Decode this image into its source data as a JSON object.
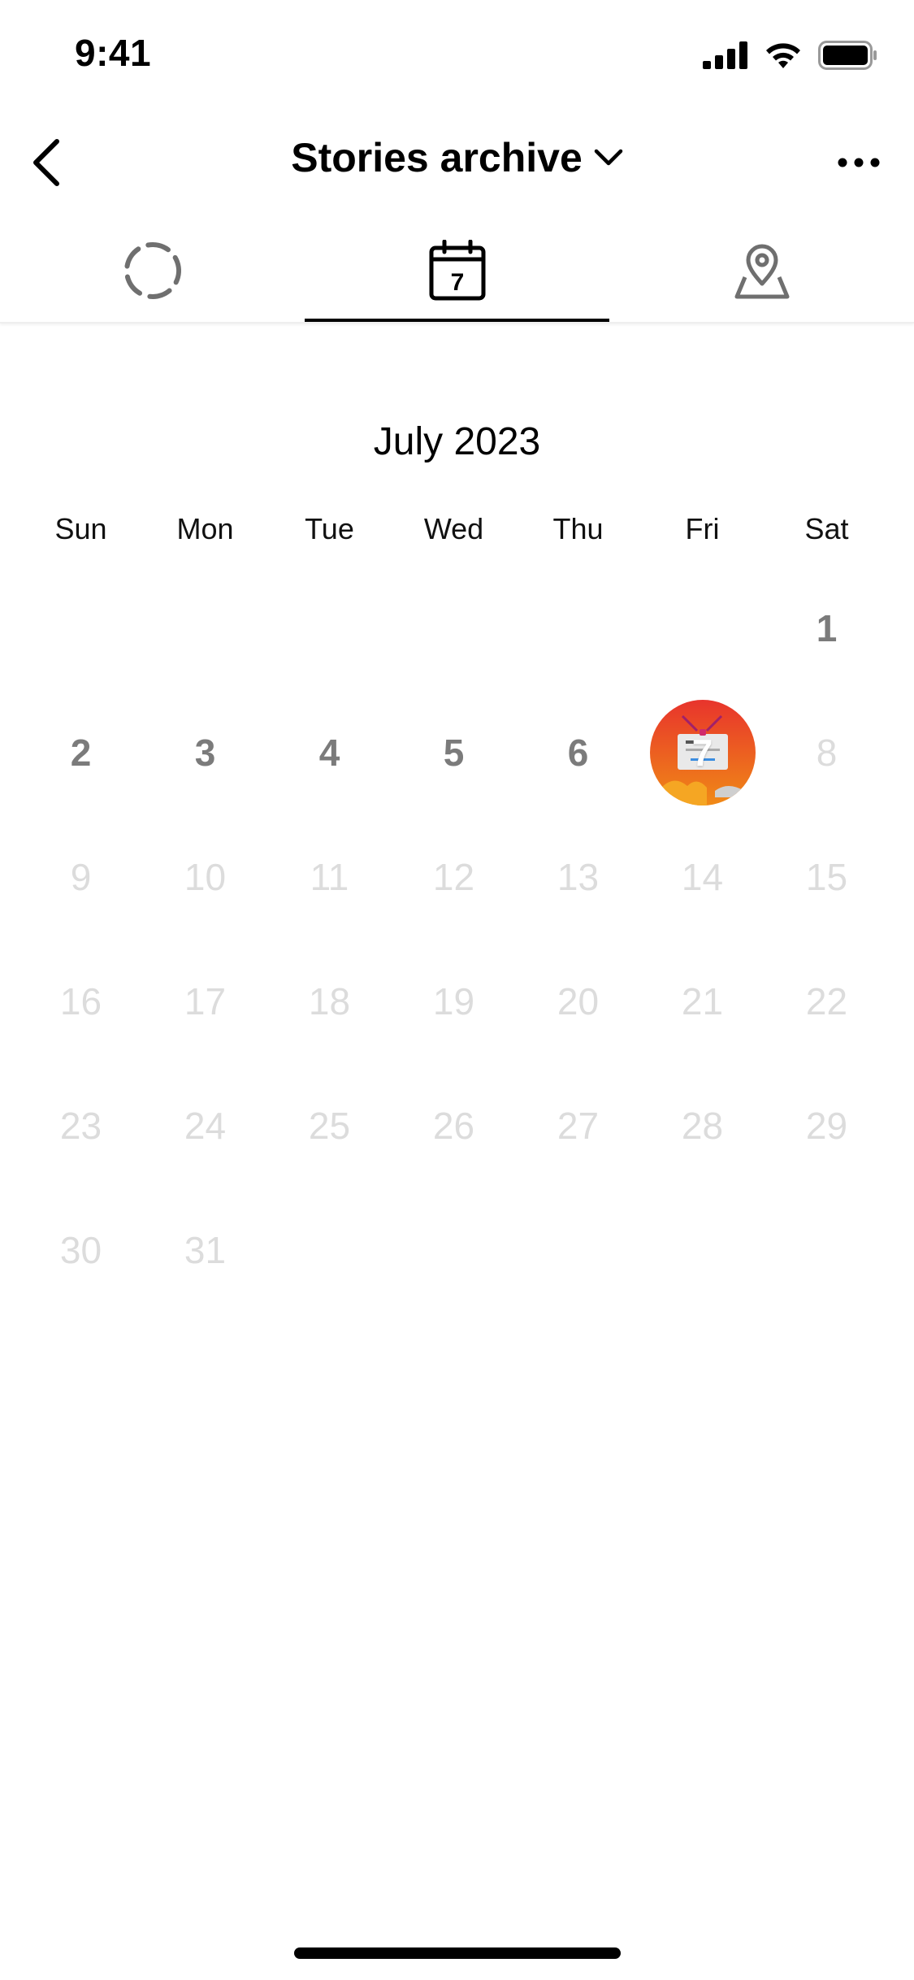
{
  "status_bar": {
    "time": "9:41",
    "icons": [
      "cellular-signal-icon",
      "wifi-icon",
      "battery-icon"
    ]
  },
  "nav": {
    "back_icon": "chevron-left-icon",
    "title": "Stories archive",
    "title_dropdown_icon": "chevron-down-icon",
    "more_icon": "more-horizontal-icon"
  },
  "tabs": [
    {
      "icon": "dashed-circle-icon",
      "active": false
    },
    {
      "icon": "calendar-icon",
      "icon_number": "7",
      "active": true
    },
    {
      "icon": "map-pin-icon",
      "active": false
    }
  ],
  "calendar": {
    "month": "July 2023",
    "weekdays": [
      "Sun",
      "Mon",
      "Tue",
      "Wed",
      "Thu",
      "Fri",
      "Sat"
    ],
    "days": [
      {
        "n": "1",
        "state": "past"
      },
      {
        "n": "2",
        "state": "past"
      },
      {
        "n": "3",
        "state": "past"
      },
      {
        "n": "4",
        "state": "past"
      },
      {
        "n": "5",
        "state": "past"
      },
      {
        "n": "6",
        "state": "past"
      },
      {
        "n": "7",
        "state": "story"
      },
      {
        "n": "8",
        "state": "future"
      },
      {
        "n": "9",
        "state": "future"
      },
      {
        "n": "10",
        "state": "future"
      },
      {
        "n": "11",
        "state": "future"
      },
      {
        "n": "12",
        "state": "future"
      },
      {
        "n": "13",
        "state": "future"
      },
      {
        "n": "14",
        "state": "future"
      },
      {
        "n": "15",
        "state": "future"
      },
      {
        "n": "16",
        "state": "future"
      },
      {
        "n": "17",
        "state": "future"
      },
      {
        "n": "18",
        "state": "future"
      },
      {
        "n": "19",
        "state": "future"
      },
      {
        "n": "20",
        "state": "future"
      },
      {
        "n": "21",
        "state": "future"
      },
      {
        "n": "22",
        "state": "future"
      },
      {
        "n": "23",
        "state": "future"
      },
      {
        "n": "24",
        "state": "future"
      },
      {
        "n": "25",
        "state": "future"
      },
      {
        "n": "26",
        "state": "future"
      },
      {
        "n": "27",
        "state": "future"
      },
      {
        "n": "28",
        "state": "future"
      },
      {
        "n": "29",
        "state": "future"
      },
      {
        "n": "30",
        "state": "future"
      },
      {
        "n": "31",
        "state": "future"
      }
    ]
  },
  "colors": {
    "past_day": "#7b7b7b",
    "future_day": "#dcdcdc",
    "story_gradient_top": "#e8342c",
    "story_gradient_bottom": "#f08a16"
  }
}
